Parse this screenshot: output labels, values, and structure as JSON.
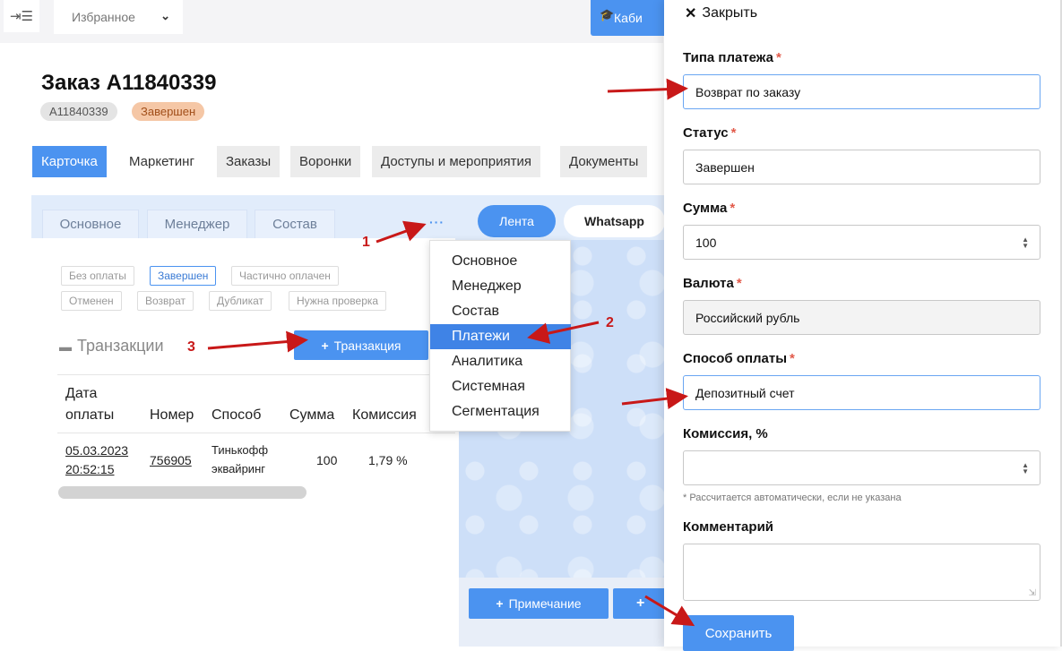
{
  "topbar": {
    "favorites_label": "Избранное",
    "cabinet_label": "Каби"
  },
  "order": {
    "title": "Заказ A11840339",
    "id_badge": "A11840339",
    "status_badge": "Завершен"
  },
  "tabs": [
    "Карточка",
    "Маркетинг",
    "Заказы",
    "Воронки",
    "Доступы и мероприятия",
    "Документы"
  ],
  "subtabs": [
    "Основное",
    "Менеджер",
    "Состав"
  ],
  "more_icon": "ellipsis-icon",
  "status_chips_row1": [
    "Без оплаты",
    "Завершен",
    "Частично оплачен"
  ],
  "status_chips_row2": [
    "Отменен",
    "Возврат",
    "Дубликат",
    "Нужна проверка"
  ],
  "transactions": {
    "title": "Транзакции",
    "add_button": "Транзакция",
    "headers": [
      "Дата оплаты",
      "Номер",
      "Способ",
      "Сумма",
      "Комиссия"
    ],
    "header_date_line1": "Дата",
    "header_date_line2": "оплаты",
    "row": {
      "date_line1": "05.03.2023",
      "date_line2": "20:52:15",
      "number": "756905",
      "method_line1": "Тинькофф",
      "method_line2": "эквайринг",
      "amount": "100",
      "commission": "1,79 %"
    }
  },
  "dropdown": {
    "items": [
      "Основное",
      "Менеджер",
      "Состав",
      "Платежи",
      "Аналитика",
      "Системная",
      "Сегментация"
    ],
    "selected": "Платежи"
  },
  "chat": {
    "tab_feed": "Лента",
    "tab_whatsapp": "Whatsapp",
    "note_button": "Примечание"
  },
  "annotations": {
    "n1": "1",
    "n2": "2",
    "n3": "3",
    "color": "#c81818"
  },
  "drawer": {
    "close_label": "Закрыть",
    "payment_type_label": "Типа платежа",
    "payment_type_value": "Возврат по заказу",
    "status_label": "Статус",
    "status_value": "Завершен",
    "amount_label": "Сумма",
    "amount_value": "100",
    "currency_label": "Валюта",
    "currency_value": "Российский рубль",
    "method_label": "Способ оплаты",
    "method_value": "Депозитный счет",
    "commission_label": "Комиссия, %",
    "commission_value": "",
    "commission_hint": "* Рассчитается автоматически, если не указана",
    "comment_label": "Комментарий",
    "comment_value": "",
    "save_button": "Сохранить",
    "required_mark": "*"
  },
  "colors": {
    "accent": "#4b93f0",
    "status_badge_bg": "#f5c7a6",
    "required": "#e25a4a"
  }
}
